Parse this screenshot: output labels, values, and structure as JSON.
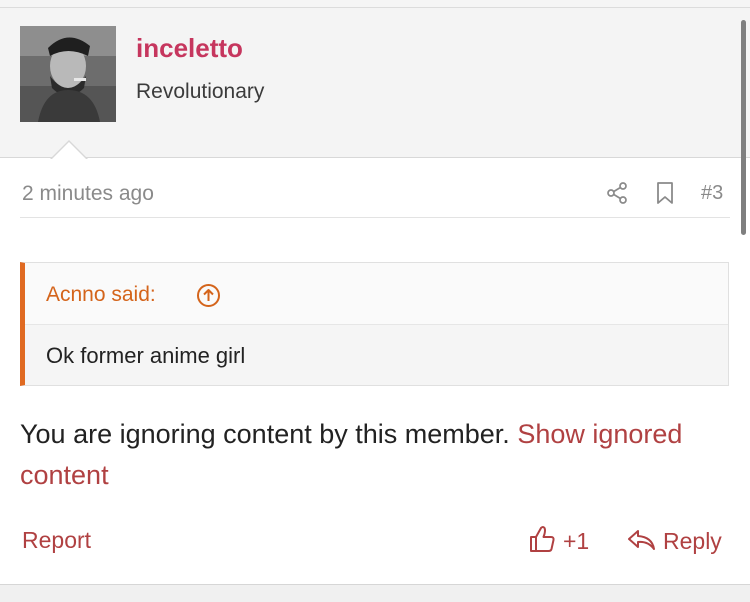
{
  "post": {
    "user": {
      "name": "inceletto",
      "title": "Revolutionary",
      "avatar_icon": "user-avatar-photo"
    },
    "meta": {
      "timestamp": "2 minutes ago",
      "share_icon": "share-icon",
      "bookmark_icon": "bookmark-icon",
      "number": "#3"
    },
    "quote": {
      "author_label": "Acnno said:",
      "arrow_icon": "arrow-up-circle-icon",
      "text": "Ok former anime girl"
    },
    "ignored": {
      "text": "You are ignoring content by this member. ",
      "link": "Show ignored content"
    },
    "footer": {
      "report_label": "Report",
      "like_icon": "thumbs-up-icon",
      "like_count": "+1",
      "reply_icon": "reply-icon",
      "reply_label": "Reply"
    }
  },
  "colors": {
    "username": "#c6365e",
    "link": "#b04142",
    "quote_accent": "#e06a22",
    "quote_author": "#d4641b",
    "muted": "#8a8a8a"
  }
}
